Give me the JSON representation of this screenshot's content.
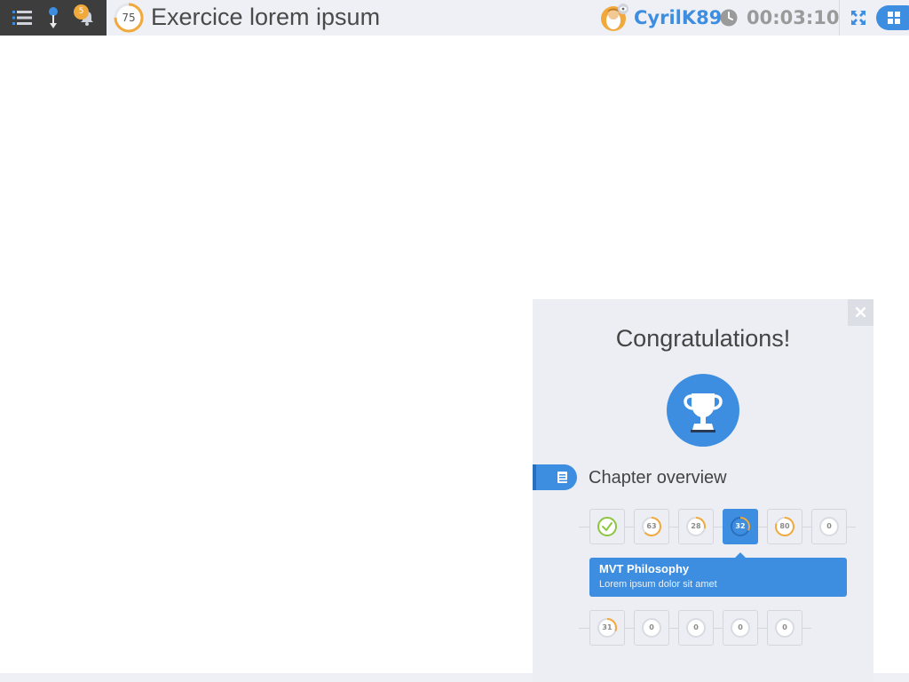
{
  "header": {
    "menu_icon": "menu-list-icon",
    "pin_icon": "pin-icon",
    "bell_icon": "bell-icon",
    "notification_count": "5",
    "score": "75",
    "score_progress": 0.75,
    "title": "Exercice lorem ipsum",
    "user": {
      "name": "CyrilK89",
      "avatar_icon": "user-avatar-icon",
      "status_icon": "eye-icon"
    },
    "clock_icon": "clock-icon",
    "timer": "00:03:10",
    "expand_icon": "expand-icon",
    "apps_icon": "grid-icon"
  },
  "colors": {
    "accent": "#3d8ee1",
    "warning": "#f2a93b",
    "success": "#8cc63f",
    "dark_bar": "#3d3d3d",
    "panel": "#eceef4"
  },
  "panel": {
    "close_icon": "close-icon",
    "heading": "Congratulations!",
    "trophy_icon": "trophy-icon",
    "chapter_icon": "book-icon",
    "chapter_label": "Chapter overview",
    "row1": [
      {
        "type": "done",
        "icon": "check-icon",
        "progress": 1.0
      },
      {
        "label": "63",
        "progress": 0.63
      },
      {
        "label": "28",
        "progress": 0.28
      },
      {
        "label": "32",
        "progress": 0.32,
        "active": true
      },
      {
        "label": "80",
        "progress": 0.8
      },
      {
        "label": "0",
        "progress": 0
      }
    ],
    "tooltip": {
      "title": "MVT Philosophy",
      "subtitle": "Lorem ipsum dolor sit amet"
    },
    "row2": [
      {
        "label": "31",
        "progress": 0.31
      },
      {
        "label": "0",
        "progress": 0
      },
      {
        "label": "0",
        "progress": 0
      },
      {
        "label": "0",
        "progress": 0
      },
      {
        "label": "0",
        "progress": 0
      }
    ]
  }
}
